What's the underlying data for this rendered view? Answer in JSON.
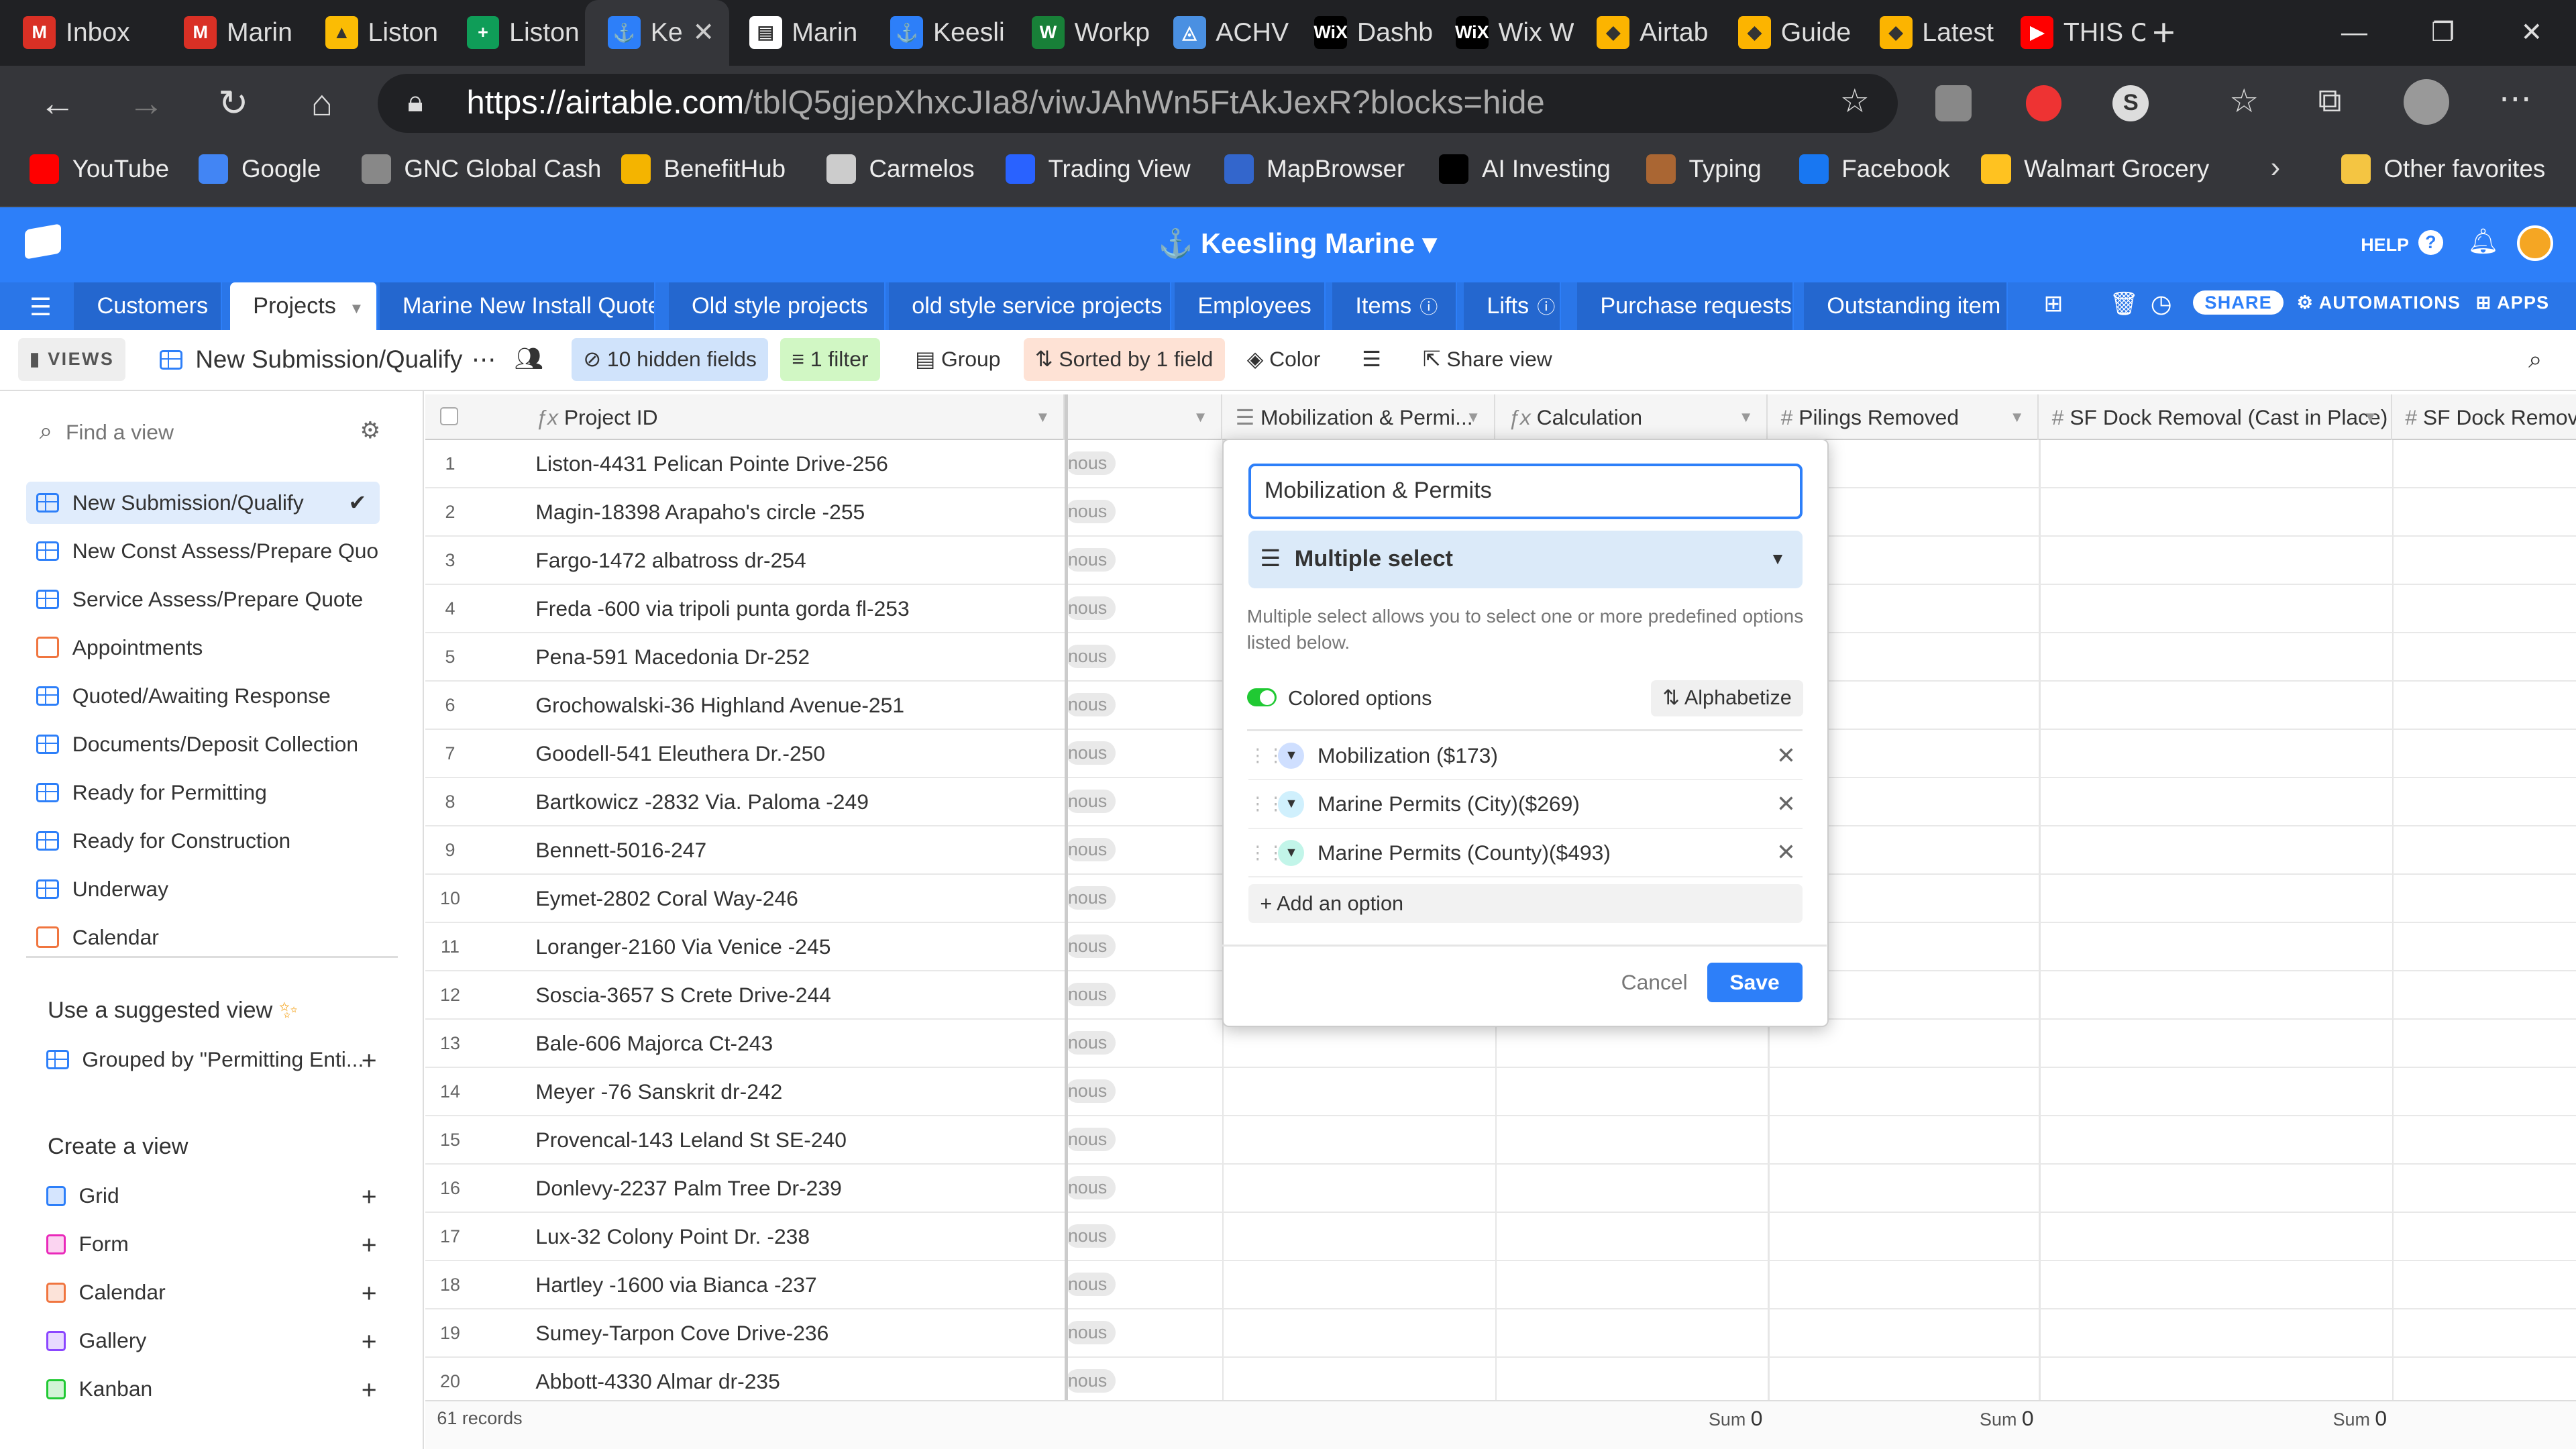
{
  "browser": {
    "tabs": [
      {
        "title": "Inbox",
        "fav": "M",
        "color": "#d93025"
      },
      {
        "title": "Marin",
        "fav": "M",
        "color": "#d93025"
      },
      {
        "title": "Liston",
        "fav": "▲",
        "color": "#fbbc04"
      },
      {
        "title": "Liston",
        "fav": "+",
        "color": "#0f9d58"
      },
      {
        "title": "Ke",
        "fav": "⚓",
        "color": "#2d7ff9"
      },
      {
        "title": "Marin",
        "fav": "▤",
        "color": "#ffffff"
      },
      {
        "title": "Keesli",
        "fav": "⚓",
        "color": "#2d7ff9"
      },
      {
        "title": "Workp",
        "fav": "W",
        "color": "#188038"
      },
      {
        "title": "ACHV",
        "fav": "◬",
        "color": "#4a90e2"
      },
      {
        "title": "Dashb",
        "fav": "WiX",
        "color": "#000000"
      },
      {
        "title": "Wix W",
        "fav": "WiX",
        "color": "#000000"
      },
      {
        "title": "Airtab",
        "fav": "◆",
        "color": "#fcb400"
      },
      {
        "title": "Guide",
        "fav": "◆",
        "color": "#fcb400"
      },
      {
        "title": "Latest",
        "fav": "◆",
        "color": "#fcb400"
      },
      {
        "title": "THIS C",
        "fav": "▶",
        "color": "#ff0000"
      }
    ],
    "url_host": "https://airtable.com",
    "url_path": "/tblQ5gjepXhxcJIa8/viwJAhWn5FtAkJexR?blocks=hide",
    "bookmarks": [
      {
        "label": "YouTube",
        "color": "#ff0000"
      },
      {
        "label": "Google",
        "color": "#4285f4"
      },
      {
        "label": "GNC Global Cash",
        "color": "#888888"
      },
      {
        "label": "BenefitHub",
        "color": "#f4b400"
      },
      {
        "label": "Carmelos",
        "color": "#cccccc"
      },
      {
        "label": "Trading View",
        "color": "#2962ff"
      },
      {
        "label": "MapBrowser",
        "color": "#3366cc"
      },
      {
        "label": "AI Investing",
        "color": "#000000"
      },
      {
        "label": "Typing",
        "color": "#aa6633"
      },
      {
        "label": "Facebook",
        "color": "#1877f2"
      },
      {
        "label": "Walmart Grocery",
        "color": "#ffc220"
      }
    ],
    "other_favorites": "Other favorites"
  },
  "app": {
    "base_title": "Keesling Marine",
    "help": "HELP",
    "table_tabs": [
      "Customers",
      "Projects",
      "Marine New Install Quote",
      "Old style projects",
      "old style service projects",
      "Employees",
      "Items",
      "Lifts",
      "Purchase requests",
      "Outstanding item"
    ],
    "share": "SHARE",
    "automations": "AUTOMATIONS",
    "apps": "APPS"
  },
  "viewbar": {
    "views_label": "VIEWS",
    "view_name": "New Submission/Qualify",
    "hidden_fields": "10 hidden fields",
    "filter": "1 filter",
    "group": "Group",
    "sorted": "Sorted by 1 field",
    "color": "Color",
    "share_view": "Share view"
  },
  "sidebar": {
    "find_placeholder": "Find a view",
    "views": [
      {
        "name": "New Submission/Qualify",
        "icon": "grid"
      },
      {
        "name": "New Const Assess/Prepare Quo...",
        "icon": "grid"
      },
      {
        "name": "Service Assess/Prepare Quote",
        "icon": "grid"
      },
      {
        "name": "Appointments",
        "icon": "calendar"
      },
      {
        "name": "Quoted/Awaiting Response",
        "icon": "grid"
      },
      {
        "name": "Documents/Deposit Collection",
        "icon": "grid"
      },
      {
        "name": "Ready for Permitting",
        "icon": "grid"
      },
      {
        "name": "Ready for Construction",
        "icon": "grid"
      },
      {
        "name": "Underway",
        "icon": "grid"
      },
      {
        "name": "Calendar",
        "icon": "calendar"
      }
    ],
    "suggested_title": "Use a suggested view",
    "suggested_item": "Grouped by \"Permitting Enti...",
    "create_title": "Create a view",
    "create_items": [
      {
        "name": "Grid",
        "color": "#2d7ff9"
      },
      {
        "name": "Form",
        "color": "#e929ba"
      },
      {
        "name": "Calendar",
        "color": "#f0753f"
      },
      {
        "name": "Gallery",
        "color": "#8b46ff"
      },
      {
        "name": "Kanban",
        "color": "#20c933"
      }
    ]
  },
  "grid": {
    "columns": [
      "Project ID",
      "Mobilization & Permi...",
      "Calculation",
      "Pilings Removed",
      "SF Dock Removal (Cast in Place)",
      "SF Dock Remova"
    ],
    "ghost_text": "nous",
    "rows": [
      "Liston-4431 Pelican Pointe Drive-256",
      "Magin-18398 Arapaho's circle -255",
      "Fargo-1472 albatross dr-254",
      "Freda -600 via tripoli punta gorda fl-253",
      "Pena-591 Macedonia Dr-252",
      "Grochowalski-36 Highland Avenue-251",
      "Goodell-541 Eleuthera Dr.-250",
      "Bartkowicz -2832 Via. Paloma -249",
      "Bennett-5016-247",
      "Eymet-2802 Coral Way-246",
      "Loranger-2160 Via Venice -245",
      "Soscia-3657 S Crete Drive-244",
      "Bale-606 Majorca Ct-243",
      "Meyer -76 Sanskrit dr-242",
      "Provencal-143 Leland St SE-240",
      "Donlevy-2237 Palm Tree Dr-239",
      "Lux-32 Colony Point Dr. -238",
      "Hartley -1600 via Bianca -237",
      "Sumey-Tarpon Cove Drive-236",
      "Abbott-4330 Almar dr-235"
    ],
    "record_count": "61 records",
    "sum_label": "Sum",
    "sum_value": "0"
  },
  "popup": {
    "field_name": "Mobilization & Permits",
    "field_type": "Multiple select",
    "description": "Multiple select allows you to select one or more predefined options listed below.",
    "colored_options": "Colored options",
    "alphabetize": "Alphabetize",
    "options": [
      {
        "label": "Mobilization ($173)",
        "color": "#cfdfff"
      },
      {
        "label": "Marine Permits (City)($269)",
        "color": "#d0f0fd"
      },
      {
        "label": "Marine Permits (County)($493)",
        "color": "#c2f5e9"
      }
    ],
    "add_option": "Add an option",
    "cancel": "Cancel",
    "save": "Save"
  }
}
